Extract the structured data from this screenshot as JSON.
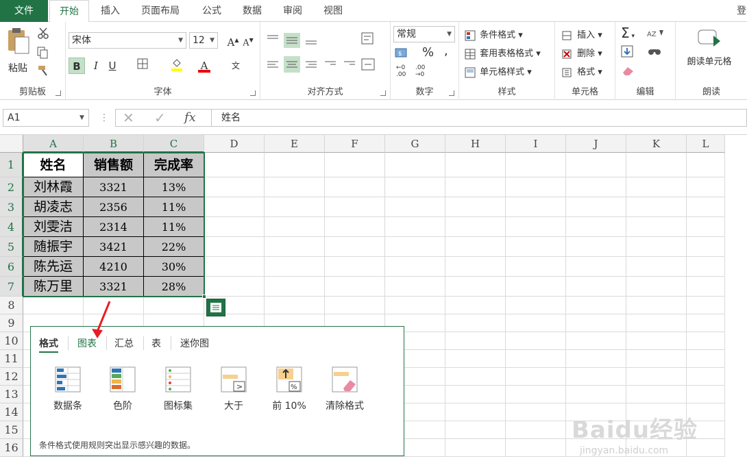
{
  "tabs": {
    "file": "文件",
    "items": [
      "开始",
      "插入",
      "页面布局",
      "公式",
      "数据",
      "审阅",
      "视图"
    ],
    "right": "登"
  },
  "ribbon": {
    "clipboard": {
      "label": "剪贴板",
      "paste": "粘贴"
    },
    "font": {
      "label": "字体",
      "family": "宋体",
      "size": "12",
      "bold": "B",
      "italic": "I",
      "underline": "U",
      "grow": "A",
      "shrink": "A",
      "wen": "文"
    },
    "alignment": {
      "label": "对齐方式"
    },
    "number": {
      "label": "数字",
      "format": "常规",
      "percent": "%",
      "comma": ","
    },
    "styles": {
      "label": "样式",
      "cond": "条件格式",
      "table": "套用表格格式",
      "cell": "单元格样式"
    },
    "cells": {
      "label": "单元格",
      "insert": "插入",
      "delete": "删除",
      "format": "格式"
    },
    "editing": {
      "label": "编辑",
      "sum": "Σ"
    },
    "read": {
      "label": "朗读",
      "btn": "朗读单元格"
    }
  },
  "formula_bar": {
    "name_box": "A1",
    "fx": "fx",
    "content": "姓名"
  },
  "sheet": {
    "columns": [
      "A",
      "B",
      "C",
      "D",
      "E",
      "F",
      "G",
      "H",
      "I",
      "J",
      "K",
      "L"
    ],
    "rows": [
      "1",
      "2",
      "3",
      "4",
      "5",
      "6",
      "7",
      "8",
      "9",
      "10",
      "11",
      "12",
      "13",
      "14",
      "15",
      "16"
    ],
    "header": [
      "姓名",
      "销售额",
      "完成率"
    ],
    "data": [
      [
        "刘林霞",
        "3321",
        "13%"
      ],
      [
        "胡凌志",
        "2356",
        "11%"
      ],
      [
        "刘雯洁",
        "2314",
        "11%"
      ],
      [
        "随振宇",
        "3421",
        "22%"
      ],
      [
        "陈先运",
        "4210",
        "30%"
      ],
      [
        "陈万里",
        "3321",
        "28%"
      ]
    ]
  },
  "quick_analysis": {
    "tabs": [
      "格式",
      "图表",
      "汇总",
      "表",
      "迷你图"
    ],
    "items": [
      "数据条",
      "色阶",
      "图标集",
      "大于",
      "前 10%",
      "清除格式"
    ],
    "description": "条件格式使用规则突出显示感兴趣的数据。"
  },
  "watermark": {
    "brand": "Baidu经验",
    "url": "jingyan.baidu.com"
  },
  "colors": {
    "accent": "#217346",
    "arrow": "#e81e25"
  }
}
